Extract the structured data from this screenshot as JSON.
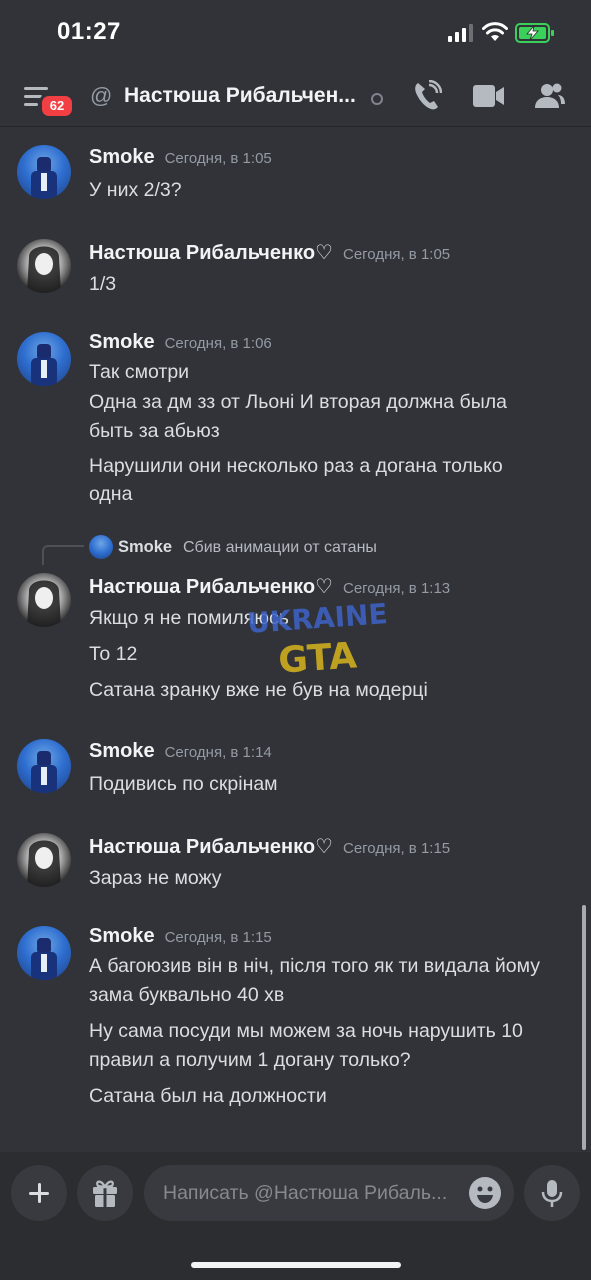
{
  "status_bar": {
    "time": "01:27"
  },
  "header": {
    "unread_badge": "62",
    "title": "Настюша Рибальчен...",
    "icons": [
      "menu-icon",
      "at-icon",
      "status-dot-icon",
      "phone-call-icon",
      "video-call-icon",
      "members-icon"
    ]
  },
  "messages": [
    {
      "author": "Smoke",
      "timestamp": "Сегодня, в 1:05",
      "lines": [
        "У них 2/3?"
      ]
    },
    {
      "author": "Настюша Рибальченко♡",
      "timestamp": "Сегодня, в 1:05",
      "lines": [
        "1/3"
      ]
    },
    {
      "author": "Smoke",
      "timestamp": "Сегодня, в 1:06",
      "lines": [
        "Так смотри",
        "Одна за дм зз от Льоні И вторая должна была",
        "быть за абьюз",
        "Нарушили они несколько раз а догана только",
        "одна"
      ]
    },
    {
      "author": "Настюша Рибальченко♡",
      "timestamp": "Сегодня, в 1:13",
      "reply": {
        "author": "Smoke",
        "text": "Сбив анимации от сатаны"
      },
      "lines": [
        "Якщо я не помиляюсь",
        "То 12",
        "Сатана зранку вже не був на модерці"
      ]
    },
    {
      "author": "Smoke",
      "timestamp": "Сегодня, в 1:14",
      "lines": [
        "Подивись по  скрінам"
      ]
    },
    {
      "author": "Настюша Рибальченко♡",
      "timestamp": "Сегодня, в 1:15",
      "lines": [
        "Зараз не можу"
      ]
    },
    {
      "author": "Smoke",
      "timestamp": "Сегодня, в 1:15",
      "lines": [
        "А багоюзив він в ніч, після того як ти видала йому",
        "зама буквально 40 хв",
        "Ну сама посуди мы можем за ночь нарушить 10",
        "правил а получим 1 догану только?",
        "Сатана был на должности"
      ]
    }
  ],
  "watermark": {
    "line1": "UKRAINE",
    "line2": "GTA"
  },
  "composer": {
    "placeholder": "Написать @Настюша Рибаль..."
  },
  "colors": {
    "background": "#313338",
    "composer_bg": "#2b2d31",
    "badge": "#f23f43",
    "battery": "#3ad05a"
  }
}
